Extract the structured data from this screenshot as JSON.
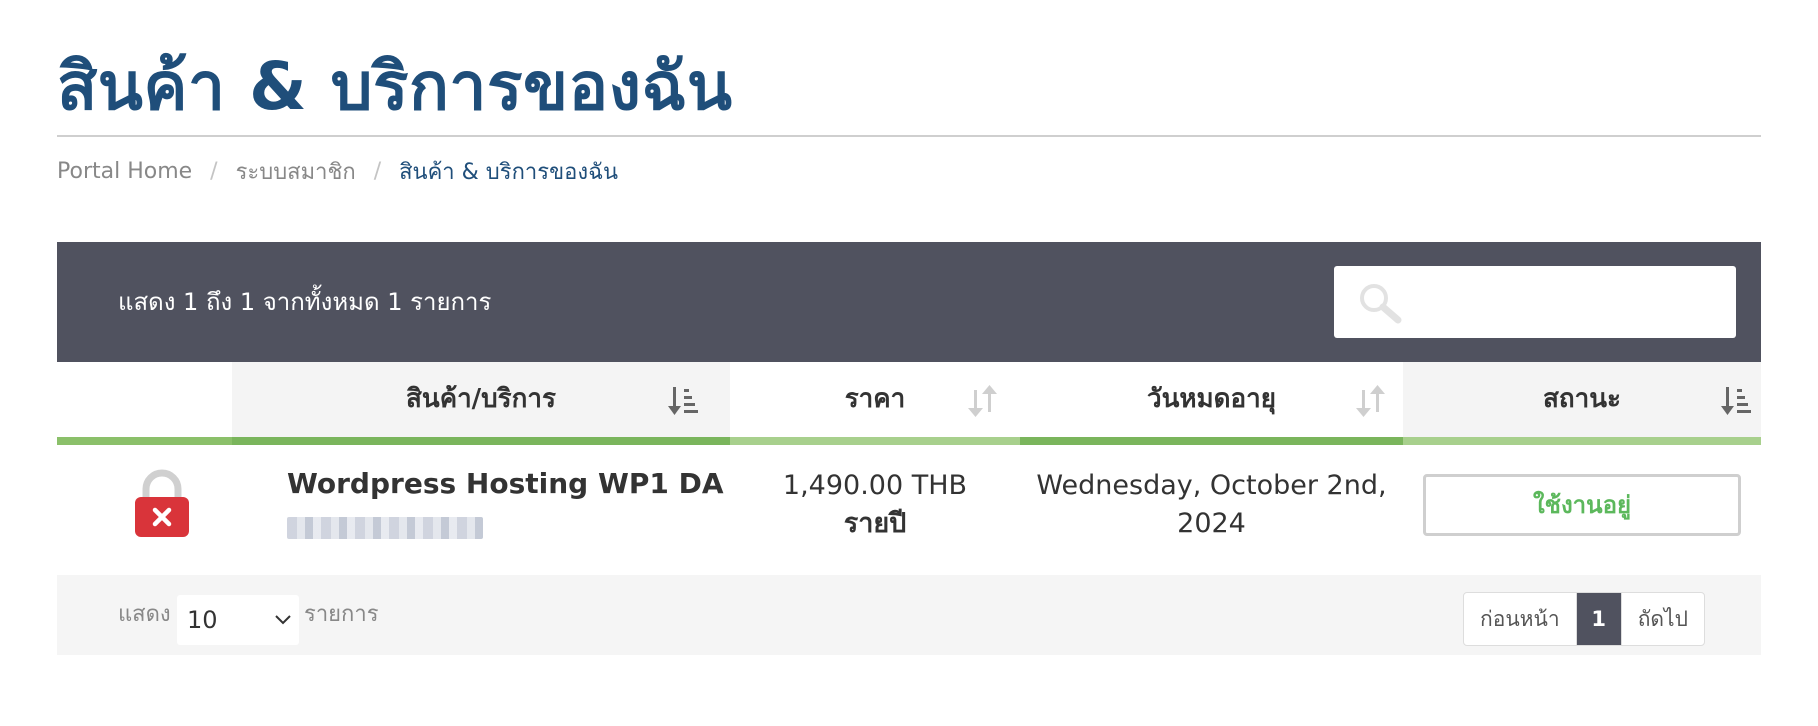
{
  "page": {
    "title": "สินค้า & บริการของฉัน"
  },
  "breadcrumb": {
    "items": [
      "Portal Home",
      "ระบบสมาชิก",
      "สินค้า & บริการของฉัน"
    ],
    "separator": "/"
  },
  "table_info": {
    "text": "แสดง 1 ถึง 1 จากทั้งหมด 1 รายการ"
  },
  "search": {
    "placeholder": "",
    "value": "",
    "icon": "search-icon"
  },
  "columns": [
    {
      "label": "",
      "sort_icon": "none",
      "underline_color": "#8bc06a"
    },
    {
      "label": "สินค้า/บริการ",
      "sort_icon": "sort-amount-down-icon",
      "underline_color": "#7ab55c"
    },
    {
      "label": "ราคา",
      "sort_icon": "sort-icon",
      "underline_color": "#a8d08d"
    },
    {
      "label": "วันหมดอายุ",
      "sort_icon": "sort-icon",
      "underline_color": "#7ab55c"
    },
    {
      "label": "สถานะ",
      "sort_icon": "sort-amount-down-icon",
      "underline_color": "#a8d08d"
    }
  ],
  "rows": [
    {
      "icon": "ssl-lock-icon",
      "product": "Wordpress Hosting WP1 DA",
      "domain": "",
      "price": "1,490.00 THB",
      "billing_cycle": "รายปี",
      "due_date": "Wednesday, October 2nd, 2024",
      "status": "ใช้งานอยู่"
    }
  ],
  "footer": {
    "show_label": "แสดง",
    "page_size": "10",
    "entries_label": "รายการ",
    "pagination": {
      "previous": "ก่อนหน้า",
      "current": "1",
      "next": "ถัดไป"
    }
  },
  "colors": {
    "title": "#1f4e7a",
    "header_bar": "#50525f",
    "status_active": "#5cb85c",
    "lock_red": "#d9343a"
  }
}
